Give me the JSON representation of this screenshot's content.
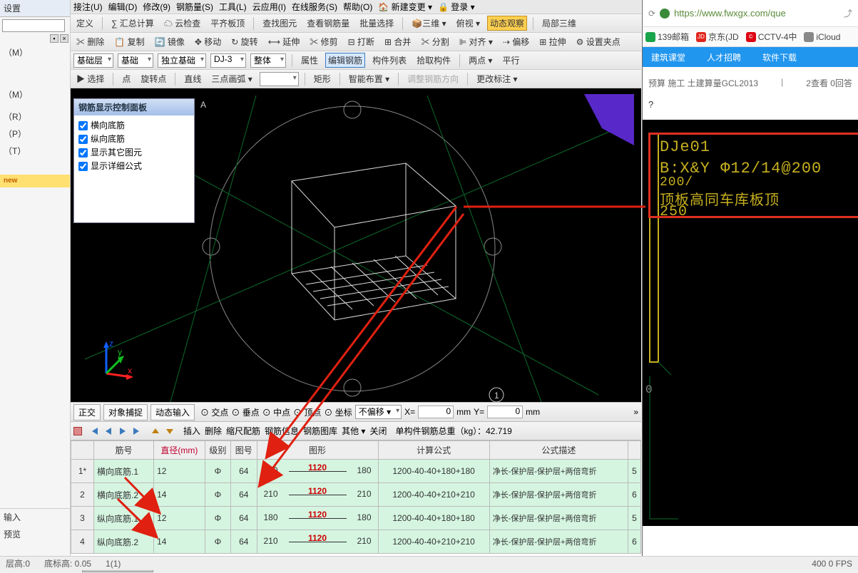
{
  "left_panel": {
    "rows": [
      "设置",
      "",
      "",
      "（M）",
      "",
      "",
      "",
      "",
      "",
      "（M）",
      "",
      "（R）",
      "（P）",
      "（T）",
      "",
      "",
      "",
      "new",
      ""
    ],
    "input_label": "输入",
    "preview_label": "预览"
  },
  "menu_top": [
    "接注(U)",
    "编辑(D)",
    "修改(9)",
    "钢筋量(S)",
    "工具(L)",
    "云应用(I)",
    "在线服务(S)",
    "帮助(O)",
    "🏠 新建变更 ▾",
    "🔒 登录 ▾"
  ],
  "toolbar1": {
    "items": [
      "定义",
      "∑ 汇总计算",
      "☁ 云检查",
      "平齐板顶",
      "查找图元",
      "查看钢筋量",
      "批量选择",
      "📦三维 ▾",
      "俯视 ▾",
      "动态观察",
      "局部三维"
    ],
    "active_index": 9
  },
  "toolbar2": {
    "items": [
      "✂ 删除",
      "📋 复制",
      "🔄 镜像",
      "✥ 移动",
      "↻ 旋转",
      "⟷ 延伸",
      "✂ 修剪",
      "⊟ 打断",
      "⊞ 合并",
      "✂ 分割",
      "⊫ 对齐 ▾",
      "⇢ 偏移",
      "⊞ 拉伸",
      "⚙ 设置夹点"
    ]
  },
  "toolbar3": {
    "layer1": "基础层",
    "layer2": "基础",
    "layer3": "独立基础",
    "layer4": "DJ-3",
    "layer5": "整体",
    "items": [
      "属性",
      "编辑钢筋",
      "构件列表",
      "拾取构件"
    ],
    "active": 1,
    "right": [
      "两点 ▾",
      "平行"
    ]
  },
  "toolbar4": {
    "items": [
      "选择",
      "点",
      "旋转点",
      "直线",
      "三点画弧 ▾"
    ],
    "rect": "矩形",
    "smart": "智能布置 ▾",
    "adjust": "调整钢筋方向",
    "modify": "更改标注 ▾"
  },
  "float_panel": {
    "title": "钢筋显示控制面板",
    "checks": [
      "横向底筋",
      "纵向底筋",
      "显示其它图元",
      "显示详细公式"
    ]
  },
  "bottom_tb": {
    "items": [
      "正交",
      "对象捕捉",
      "动态输入"
    ],
    "snaps": [
      "交点",
      "垂点",
      "中点",
      "顶点",
      "坐标"
    ],
    "offset_label": "不偏移 ▾",
    "x": "X=",
    "xv": "0",
    "xu": "mm",
    "y": "Y=",
    "yv": "0",
    "yu": "mm"
  },
  "grid_tb": {
    "btns": [
      "插入",
      "删除",
      "缩尺配筋",
      "钢筋信息",
      "钢筋图库",
      "其他 ▾",
      "关闭"
    ],
    "total_label": "单构件钢筋总重（kg）：",
    "total_val": "42.719"
  },
  "grid": {
    "headers": [
      "",
      "筋号",
      "直径(mm)",
      "级别",
      "图号",
      "图形",
      "计算公式",
      "公式描述",
      ""
    ],
    "rows": [
      {
        "n": "1*",
        "name": "横向底筋.1",
        "dia": "12",
        "grade": "Φ",
        "code": "64",
        "figL": "180",
        "figC": "1120",
        "figR": "180",
        "formula": "1200-40-40+180+180",
        "desc": "净长-保护层-保护层+两倍弯折",
        "tail": "5"
      },
      {
        "n": "2",
        "name": "横向底筋.2",
        "dia": "14",
        "grade": "Φ",
        "code": "64",
        "figL": "210",
        "figC": "1120",
        "figR": "210",
        "formula": "1200-40-40+210+210",
        "desc": "净长-保护层-保护层+两倍弯折",
        "tail": "6"
      },
      {
        "n": "3",
        "name": "纵向底筋.1",
        "dia": "12",
        "grade": "Φ",
        "code": "64",
        "figL": "180",
        "figC": "1120",
        "figR": "180",
        "formula": "1200-40-40+180+180",
        "desc": "净长-保护层-保护层+两倍弯折",
        "tail": "5"
      },
      {
        "n": "4",
        "name": "纵向底筋.2",
        "dia": "14",
        "grade": "Φ",
        "code": "64",
        "figL": "210",
        "figC": "1120",
        "figR": "210",
        "formula": "1200-40-40+210+210",
        "desc": "净长-保护层-保护层+两倍弯折",
        "tail": "6"
      }
    ]
  },
  "browser": {
    "url": "https://www.fwxgx.com/que",
    "bookmarks": [
      {
        "t": "139邮箱",
        "c": "#19a34a"
      },
      {
        "t": "京东(JD",
        "c": "#e1251b",
        "p": "JD"
      },
      {
        "t": "CCTV-4中",
        "c": "#d01",
        "p": "©"
      },
      {
        "t": "iCloud",
        "c": "#888",
        "p": ""
      }
    ],
    "nav": [
      "建筑课堂",
      "人才招聘",
      "软件下载"
    ],
    "meta_left": "预算 施工 土建算量GCL2013",
    "meta_right": "2查看  0回答",
    "question": "?",
    "annot": [
      "DJe01",
      "B:X&Y Φ12/14@200",
      "200/",
      "顶板高同车库板顶",
      "250"
    ],
    "small": "0"
  },
  "status": {
    "l": "层高:0",
    "m": "底标高: 0.05",
    "r": "1(1)",
    "far": "400 0 FPS"
  }
}
